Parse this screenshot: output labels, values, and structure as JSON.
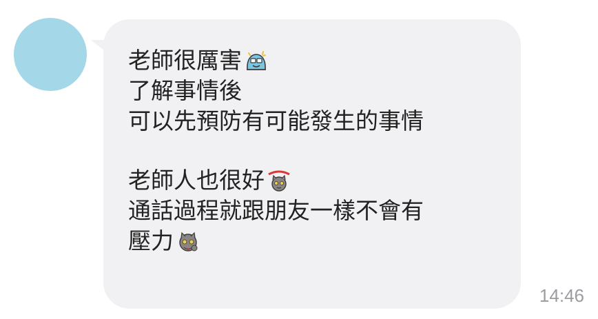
{
  "message": {
    "lines": [
      "老師很厲害",
      "了解事情後",
      "可以先預防有可能發生的事情",
      "",
      "老師人也很好",
      "通話過程就跟朋友一樣不會有",
      "壓力"
    ],
    "emojis": {
      "line_0": "excited-blob-emoji",
      "line_4": "bravo-cat-emoji",
      "line_6": "shy-cat-emoji"
    },
    "timestamp": "14:46"
  },
  "colors": {
    "avatar": "#a4d8e9",
    "bubble": "#f1f1f4",
    "text": "#222222",
    "timestamp": "#9c9ca2"
  }
}
